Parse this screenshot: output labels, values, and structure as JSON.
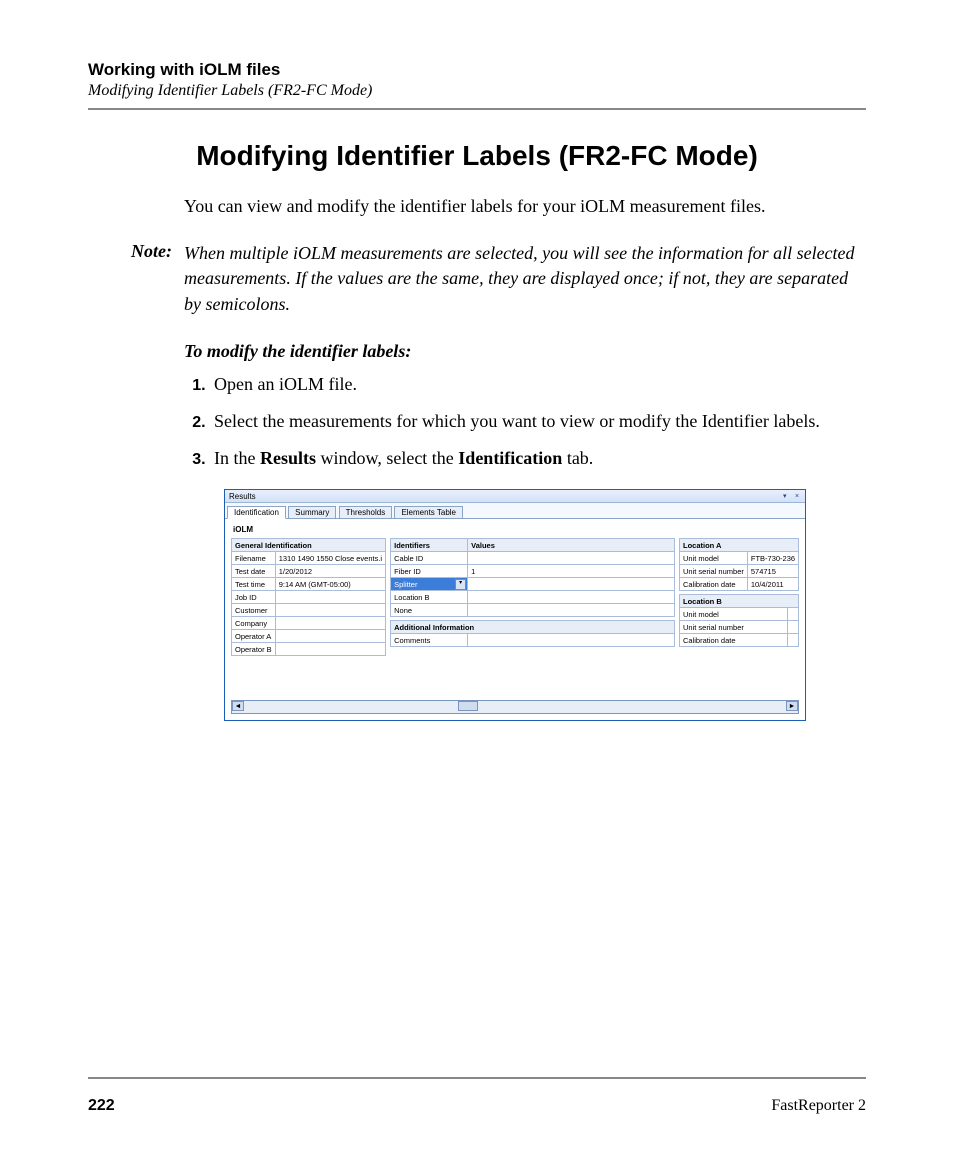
{
  "header": {
    "chapter": "Working with iOLM files",
    "section": "Modifying Identifier Labels (FR2-FC Mode)"
  },
  "main": {
    "title": "Modifying Identifier Labels (FR2-FC Mode)",
    "intro": "You can view and modify the identifier labels for your iOLM measurement files.",
    "note_label": "Note:",
    "note": "When multiple iOLM measurements are selected, you will see the information for all selected measurements. If the values are the same, they are displayed once; if not, they are separated by semicolons.",
    "proc_title": "To modify the identifier labels:",
    "steps": {
      "s1": "Open an iOLM file.",
      "s2": "Select the measurements for which you want to view or modify the Identifier labels.",
      "s3_a": "In the ",
      "s3_b": "Results",
      "s3_c": " window, select the ",
      "s3_d": "Identification",
      "s3_e": " tab."
    }
  },
  "panel": {
    "title": "Results",
    "pin_glyph": "▾",
    "close_glyph": "×",
    "tabs": {
      "identification": "Identification",
      "summary": "Summary",
      "thresholds": "Thresholds",
      "elements": "Elements Table"
    },
    "iolm": "iOLM",
    "general_header": "General Identification",
    "general_rows": {
      "filename_l": "Filename",
      "filename_v": "1310 1490 1550 Close events.i",
      "testdate_l": "Test date",
      "testdate_v": "1/20/2012",
      "testtime_l": "Test time",
      "testtime_v": "9:14 AM (GMT-05:00)",
      "jobid_l": "Job ID",
      "jobid_v": "",
      "customer_l": "Customer",
      "customer_v": "",
      "company_l": "Company",
      "company_v": "",
      "opa_l": "Operator A",
      "opa_v": "",
      "opb_l": "Operator B",
      "opb_v": ""
    },
    "ident_header": "Identifiers",
    "values_header": "Values",
    "ident_rows": {
      "cable_l": "Cable ID",
      "cable_v": "",
      "fiber_l": "Fiber ID",
      "fiber_v": "1",
      "splitter_l": "Splitter",
      "splitter_v": "",
      "locb_l": "Location B",
      "locb_v": "",
      "none_l": "None",
      "none_v": ""
    },
    "addl_header": "Additional Information",
    "addl_rows": {
      "comments_l": "Comments",
      "comments_v": ""
    },
    "loc_a_header": "Location A",
    "loc_a_rows": {
      "model_l": "Unit model",
      "model_v": "FTB-730-236",
      "serial_l": "Unit serial number",
      "serial_v": "574715",
      "cal_l": "Calibration date",
      "cal_v": "10/4/2011"
    },
    "loc_b_header": "Location B",
    "loc_b_rows": {
      "model_l": "Unit model",
      "model_v": "",
      "serial_l": "Unit serial number",
      "serial_v": "",
      "cal_l": "Calibration date",
      "cal_v": ""
    },
    "scroll_left": "◄",
    "scroll_right": "►"
  },
  "footer": {
    "page": "222",
    "product": "FastReporter 2"
  }
}
